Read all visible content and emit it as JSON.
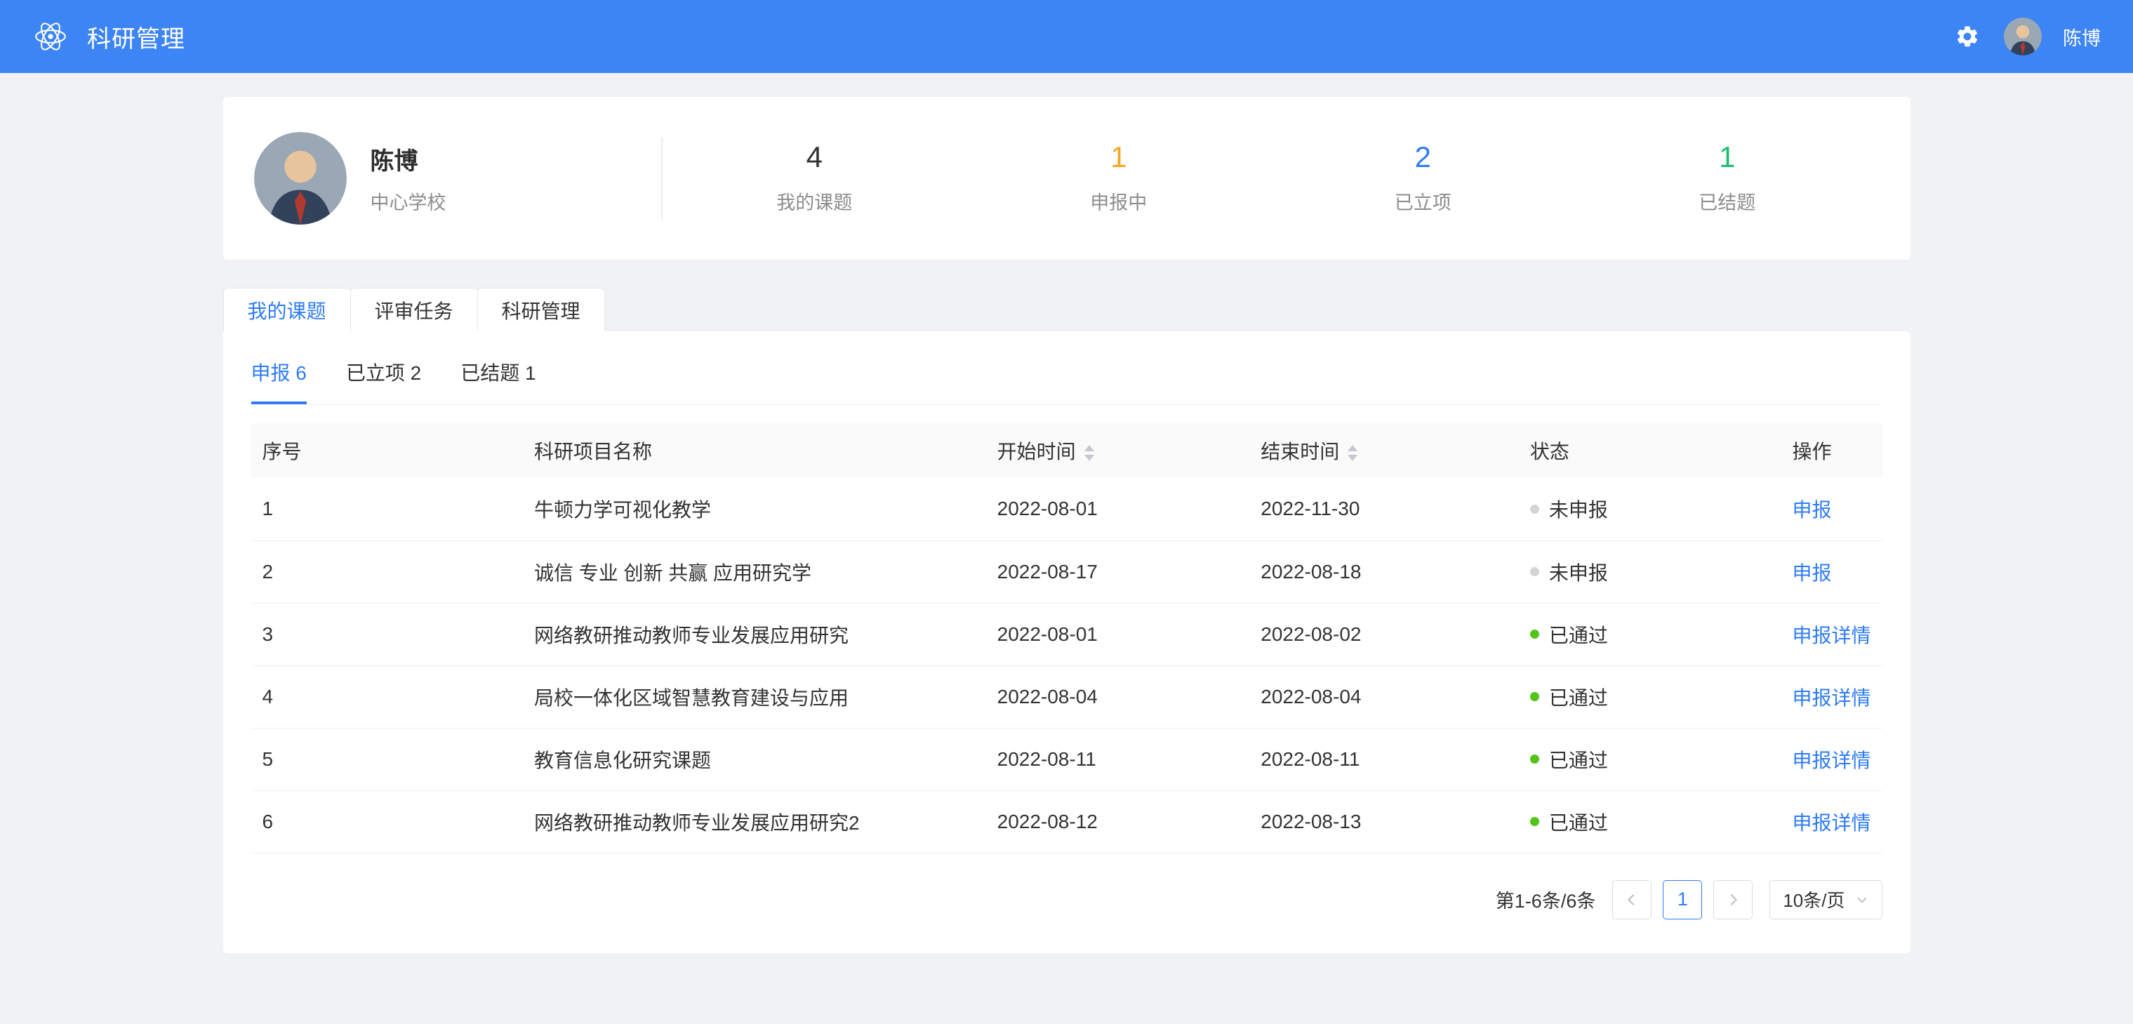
{
  "colors": {
    "header_bg": "#3d84f5",
    "link": "#2f7cf6",
    "dot_green": "#52c41a",
    "dot_gray": "#d4d4d4"
  },
  "header": {
    "app_title": "科研管理",
    "user_name": "陈博"
  },
  "profile": {
    "name": "陈博",
    "org": "中心学校",
    "stats": [
      {
        "value": "4",
        "label": "我的课题",
        "color": "#333333"
      },
      {
        "value": "1",
        "label": "申报中",
        "color": "#f5a623"
      },
      {
        "value": "2",
        "label": "已立项",
        "color": "#2f7cf6"
      },
      {
        "value": "1",
        "label": "已结题",
        "color": "#1cbe6e"
      }
    ]
  },
  "tabs": [
    {
      "label": "我的课题"
    },
    {
      "label": "评审任务"
    },
    {
      "label": "科研管理"
    }
  ],
  "subtabs": [
    {
      "label": "申报 6"
    },
    {
      "label": "已立项 2"
    },
    {
      "label": "已结题 1"
    }
  ],
  "table": {
    "columns": {
      "index": "序号",
      "name": "科研项目名称",
      "start": "开始时间",
      "end": "结束时间",
      "status": "状态",
      "action": "操作"
    },
    "rows": [
      {
        "index": "1",
        "name": "牛顿力学可视化教学",
        "start": "2022-08-01",
        "end": "2022-11-30",
        "status": "未申报",
        "status_type": "gray",
        "action": "申报"
      },
      {
        "index": "2",
        "name": "诚信 专业 创新 共赢 应用研究学",
        "start": "2022-08-17",
        "end": "2022-08-18",
        "status": "未申报",
        "status_type": "gray",
        "action": "申报"
      },
      {
        "index": "3",
        "name": "网络教研推动教师专业发展应用研究",
        "start": "2022-08-01",
        "end": "2022-08-02",
        "status": "已通过",
        "status_type": "green",
        "action": "申报详情"
      },
      {
        "index": "4",
        "name": "局校一体化区域智慧教育建设与应用",
        "start": "2022-08-04",
        "end": "2022-08-04",
        "status": "已通过",
        "status_type": "green",
        "action": "申报详情"
      },
      {
        "index": "5",
        "name": "教育信息化研究课题",
        "start": "2022-08-11",
        "end": "2022-08-11",
        "status": "已通过",
        "status_type": "green",
        "action": "申报详情"
      },
      {
        "index": "6",
        "name": "网络教研推动教师专业发展应用研究2",
        "start": "2022-08-12",
        "end": "2022-08-13",
        "status": "已通过",
        "status_type": "green",
        "action": "申报详情"
      }
    ]
  },
  "pagination": {
    "summary": "第1-6条/6条",
    "page": "1",
    "page_size": "10条/页"
  }
}
